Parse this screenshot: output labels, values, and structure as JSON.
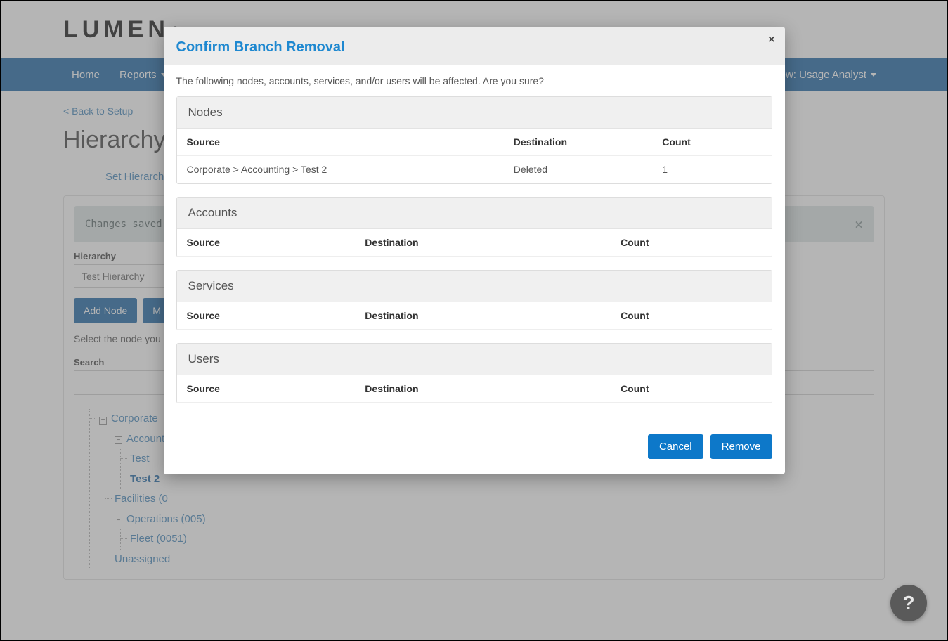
{
  "brand": "LUMEN",
  "nav": {
    "left": [
      "Home",
      "Reports"
    ],
    "view_label": "View: Usage Analyst"
  },
  "page": {
    "back": "< Back to Setup",
    "title": "Hierarchy",
    "tabs": [
      "Set Hierarchy"
    ],
    "alert": "Changes saved",
    "hierarchy_label": "Hierarchy",
    "hierarchy_value": "Test Hierarchy",
    "buttons": {
      "add_node": "Add Node",
      "m": "M"
    },
    "instruction": "Select the node you",
    "search_label": "Search"
  },
  "tree": {
    "root": "Corporate",
    "children": [
      {
        "label": "Accounti",
        "expanded": true,
        "children": [
          {
            "label": "Test"
          },
          {
            "label": "Test 2",
            "selected": true
          }
        ]
      },
      {
        "label": "Facilities (0"
      },
      {
        "label": "Operations (005)",
        "expanded": true,
        "children": [
          {
            "label": "Fleet (0051)"
          }
        ]
      },
      {
        "label": "Unassigned"
      }
    ]
  },
  "modal": {
    "title": "Confirm Branch Removal",
    "message": "The following nodes, accounts, services, and/or users will be affected. Are you sure?",
    "sections": {
      "nodes": {
        "title": "Nodes",
        "headers": [
          "Source",
          "Destination",
          "Count"
        ],
        "rows": [
          {
            "source": "Corporate > Accounting > Test 2",
            "destination": "Deleted",
            "count": "1"
          }
        ]
      },
      "accounts": {
        "title": "Accounts",
        "headers": [
          "Source",
          "Destination",
          "Count"
        ],
        "rows": []
      },
      "services": {
        "title": "Services",
        "headers": [
          "Source",
          "Destination",
          "Count"
        ],
        "rows": []
      },
      "users": {
        "title": "Users",
        "headers": [
          "Source",
          "Destination",
          "Count"
        ],
        "rows": []
      }
    },
    "buttons": {
      "cancel": "Cancel",
      "remove": "Remove"
    }
  },
  "help": "?"
}
